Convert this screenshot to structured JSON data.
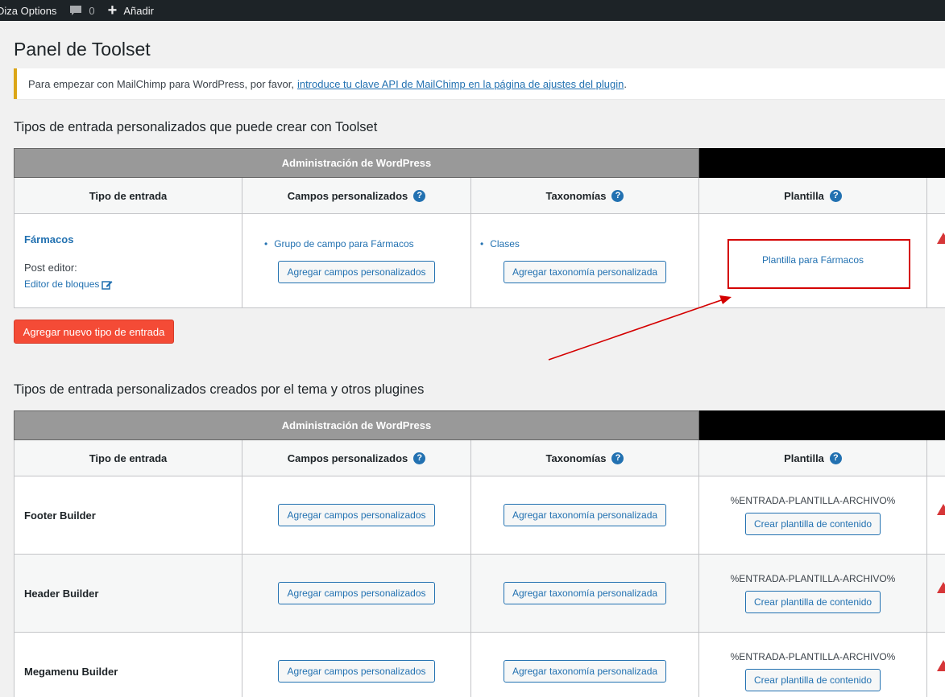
{
  "adminbar": {
    "site_label": "Diza Options",
    "comments_count": "0",
    "new_label": "Añadir"
  },
  "page": {
    "title": "Panel de Toolset"
  },
  "notice": {
    "text": "Para empezar con MailChimp para WordPress, por favor,",
    "link": "introduce tu clave API de MailChimp en la página de ajustes del plugin",
    "suffix": "."
  },
  "section1": {
    "heading": "Tipos de entrada personalizados que puede crear con Toolset",
    "group_label": "Administración de WordPress",
    "headers": [
      "Tipo de entrada",
      "Campos personalizados",
      "Taxonomías",
      "Plantilla"
    ],
    "row": {
      "name": "Fármacos",
      "post_editor_label": "Post editor:",
      "post_editor_link": "Editor de bloques",
      "field_group": "Grupo de campo para Fármacos",
      "add_fields_btn": "Agregar campos personalizados",
      "taxonomy": "Clases",
      "add_tax_btn": "Agregar taxonomía personalizada",
      "template": "Plantilla para Fármacos"
    },
    "add_type_btn": "Agregar nuevo tipo de entrada"
  },
  "section2": {
    "heading": "Tipos de entrada personalizados creados por el tema y otros plugines",
    "group_label": "Administración de WordPress",
    "headers": [
      "Tipo de entrada",
      "Campos personalizados",
      "Taxonomías",
      "Plantilla"
    ],
    "rows": [
      {
        "name": "Footer Builder",
        "add_fields_btn": "Agregar campos personalizados",
        "add_tax_btn": "Agregar taxonomía personalizada",
        "template_code": "%ENTRADA-PLANTILLA-ARCHIVO%",
        "create_tpl_btn": "Crear plantilla de contenido"
      },
      {
        "name": "Header Builder",
        "add_fields_btn": "Agregar campos personalizados",
        "add_tax_btn": "Agregar taxonomía personalizada",
        "template_code": "%ENTRADA-PLANTILLA-ARCHIVO%",
        "create_tpl_btn": "Crear plantilla de contenido"
      },
      {
        "name": "Megamenu Builder",
        "add_fields_btn": "Agregar campos personalizados",
        "add_tax_btn": "Agregar taxonomía personalizada",
        "template_code": "%ENTRADA-PLANTILLA-ARCHIVO%",
        "create_tpl_btn": "Crear plantilla de contenido"
      }
    ]
  },
  "colors": {
    "accent": "#2271b1",
    "add_button": "#f44b36",
    "annotation": "#d40000",
    "warning": "#d63638"
  }
}
